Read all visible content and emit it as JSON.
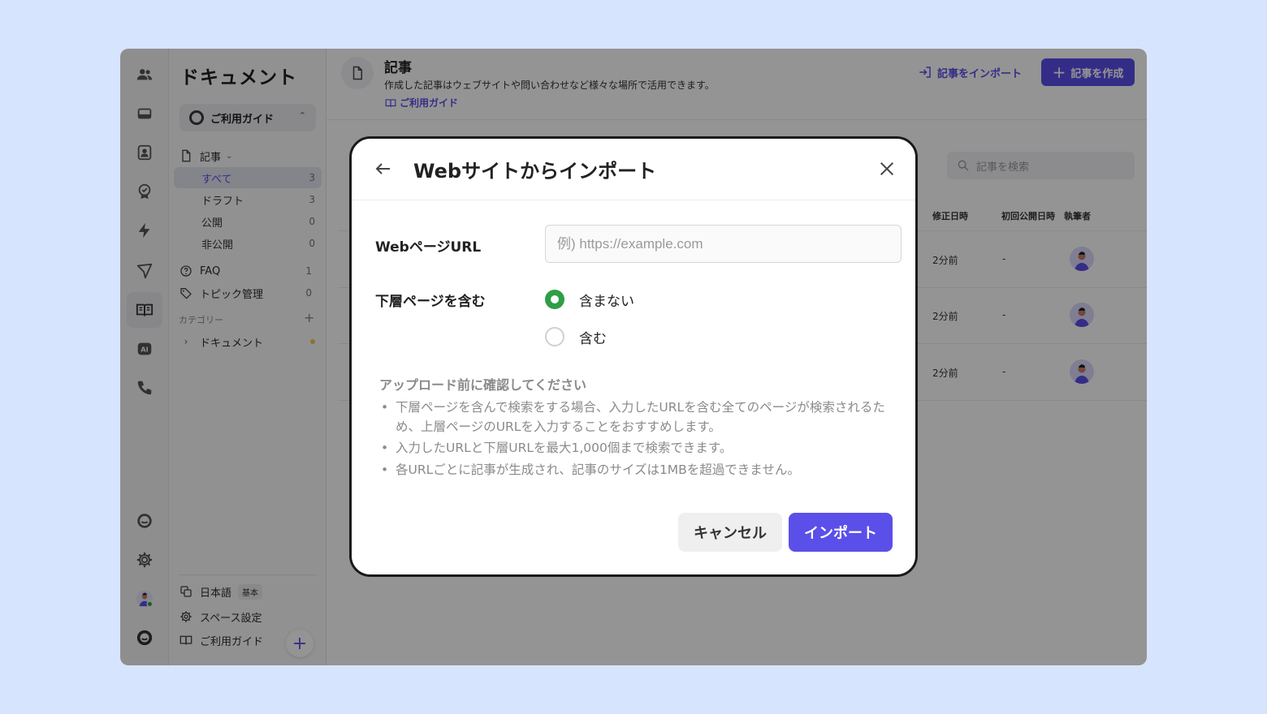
{
  "sidenav": {
    "title": "ドキュメント",
    "space_name": "ご利用ガイド",
    "articles_label": "記事",
    "sub_items": [
      {
        "label": "すべて",
        "count": "3"
      },
      {
        "label": "ドラフト",
        "count": "3"
      },
      {
        "label": "公開",
        "count": "0"
      },
      {
        "label": "非公開",
        "count": "0"
      }
    ],
    "faq_label": "FAQ",
    "faq_count": "1",
    "topic_label": "トピック管理",
    "topic_count": "0",
    "category_label": "カテゴリー",
    "category_item": "ドキュメント",
    "language_label": "日本語",
    "language_badge": "基本",
    "space_settings_label": "スペース設定",
    "guide_label": "ご利用ガイド"
  },
  "header": {
    "title": "記事",
    "subtitle": "作成した記事はウェブサイトや問い合わせなど様々な場所で活用できます。",
    "guide_link": "ご利用ガイド",
    "import_label": "記事をインポート",
    "create_label": "記事を作成",
    "search_placeholder": "記事を検索"
  },
  "table": {
    "columns": [
      "修正日時",
      "初回公開日時",
      "執筆者"
    ],
    "rows": [
      {
        "modified": "2分前",
        "first_published": "-"
      },
      {
        "modified": "2分前",
        "first_published": "-"
      },
      {
        "modified": "2分前",
        "first_published": "-"
      }
    ]
  },
  "modal": {
    "title": "Webサイトからインポート",
    "url_label": "WebページURL",
    "url_placeholder": "例) https://example.com",
    "url_value": "",
    "subpages_label": "下層ページを含む",
    "options": [
      "含まない",
      "含む"
    ],
    "selected_option": "含まない",
    "note_title": "アップロード前に確認してください",
    "notes": [
      "下層ページを含んで検索をする場合、入力したURLを含む全てのページが検索されるため、上層ページのURLを入力することをおすすめします。",
      "入力したURLと下層URLを最大1,000個まで検索できます。",
      "各URLごとに記事が生成され、記事のサイズは1MBを超過できません。"
    ],
    "cancel_label": "キャンセル",
    "import_label": "インポート"
  },
  "colors": {
    "accent": "#5b4fe9",
    "radio_checked": "#2f9e47",
    "page_background": "#d6e4fe"
  }
}
